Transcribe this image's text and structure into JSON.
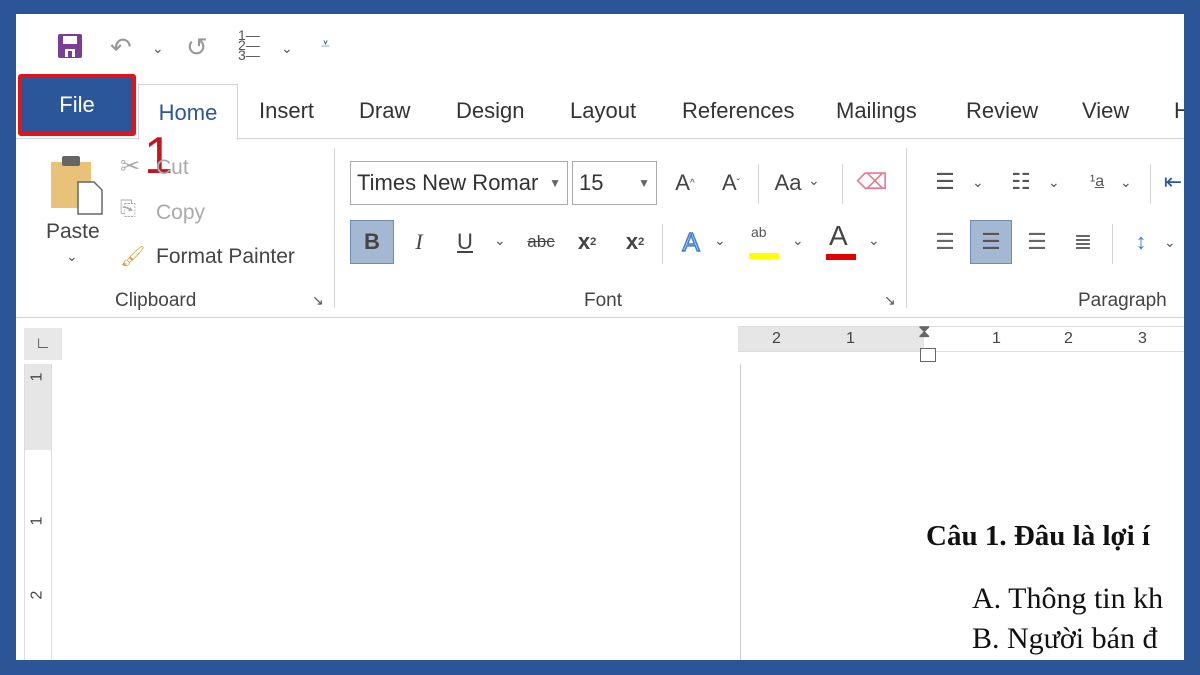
{
  "quick_access": {
    "icons": [
      "save-icon",
      "undo-icon",
      "redo-icon",
      "numbering-icon",
      "customize-icon"
    ]
  },
  "tabs": [
    "File",
    "Home",
    "Insert",
    "Draw",
    "Design",
    "Layout",
    "References",
    "Mailings",
    "Review",
    "View",
    "H"
  ],
  "active_tab": "Home",
  "annotation": {
    "step": "1",
    "highlight_color": "#e0141e"
  },
  "clipboard": {
    "paste": "Paste",
    "cut": "Cut",
    "copy": "Copy",
    "format_painter": "Format Painter",
    "group_label": "Clipboard"
  },
  "font": {
    "font_name": "Times New Romar",
    "font_size": "15",
    "case_label": "Aa",
    "bold": "B",
    "italic": "I",
    "underline": "U",
    "strike": "abc",
    "subscript": "x",
    "subscript_mark": "2",
    "superscript": "x",
    "superscript_mark": "2",
    "text_effect": "A",
    "highlight": "ab",
    "font_color": "A",
    "highlight_color": "#ffff00",
    "font_color_value": "#e00000",
    "group_label": "Font",
    "bold_active": true
  },
  "paragraph": {
    "group_label": "Paragraph",
    "align_center_active": true
  },
  "ruler": {
    "horizontal": [
      "2",
      "1",
      "1",
      "2",
      "3"
    ],
    "vertical": [
      "1",
      "1",
      "2"
    ]
  },
  "document": {
    "heading": "Câu 1. Đâu là lợi í",
    "option_a": "A.  Thông tin kh",
    "option_b": "B.  Người bán đ"
  },
  "colors": {
    "frame": "#2b5597",
    "file_tab": "#2b579a",
    "selected_button": "#a5b8d3"
  }
}
